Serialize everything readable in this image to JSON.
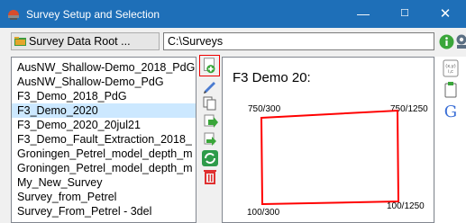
{
  "window": {
    "title": "Survey Setup and Selection",
    "min_label": "—",
    "max_label": "☐",
    "close_label": "✕"
  },
  "toolbar": {
    "root_label": "Survey Data Root ...",
    "path_value": "C:\\Surveys"
  },
  "surveys": [
    "AusNW_Shallow-Demo_2018_PdG",
    "AusNW_Shallow-Demo_PdG",
    "F3_Demo_2018_PdG",
    "F3_Demo_2020",
    "F3_Demo_2020_20jul21",
    "F3_Demo_Fault_Extraction_2018_",
    "Groningen_Petrel_model_depth_m",
    "Groningen_Petrel_model_depth_m",
    "My_New_Survey",
    "Survey_from_Petrel",
    "Survey_From_Petrel - 3del"
  ],
  "selected_index": 3,
  "map": {
    "title": "F3 Demo 20:",
    "corners": {
      "top_left": "750/300",
      "top_right": "750/1250",
      "bottom_left": "100/300",
      "bottom_right": "100/1250"
    },
    "outline_color": "#ff0000"
  },
  "colors": {
    "titlebar": "#1e6fb8",
    "selection": "#cce8ff",
    "highlight": "#e00000"
  }
}
